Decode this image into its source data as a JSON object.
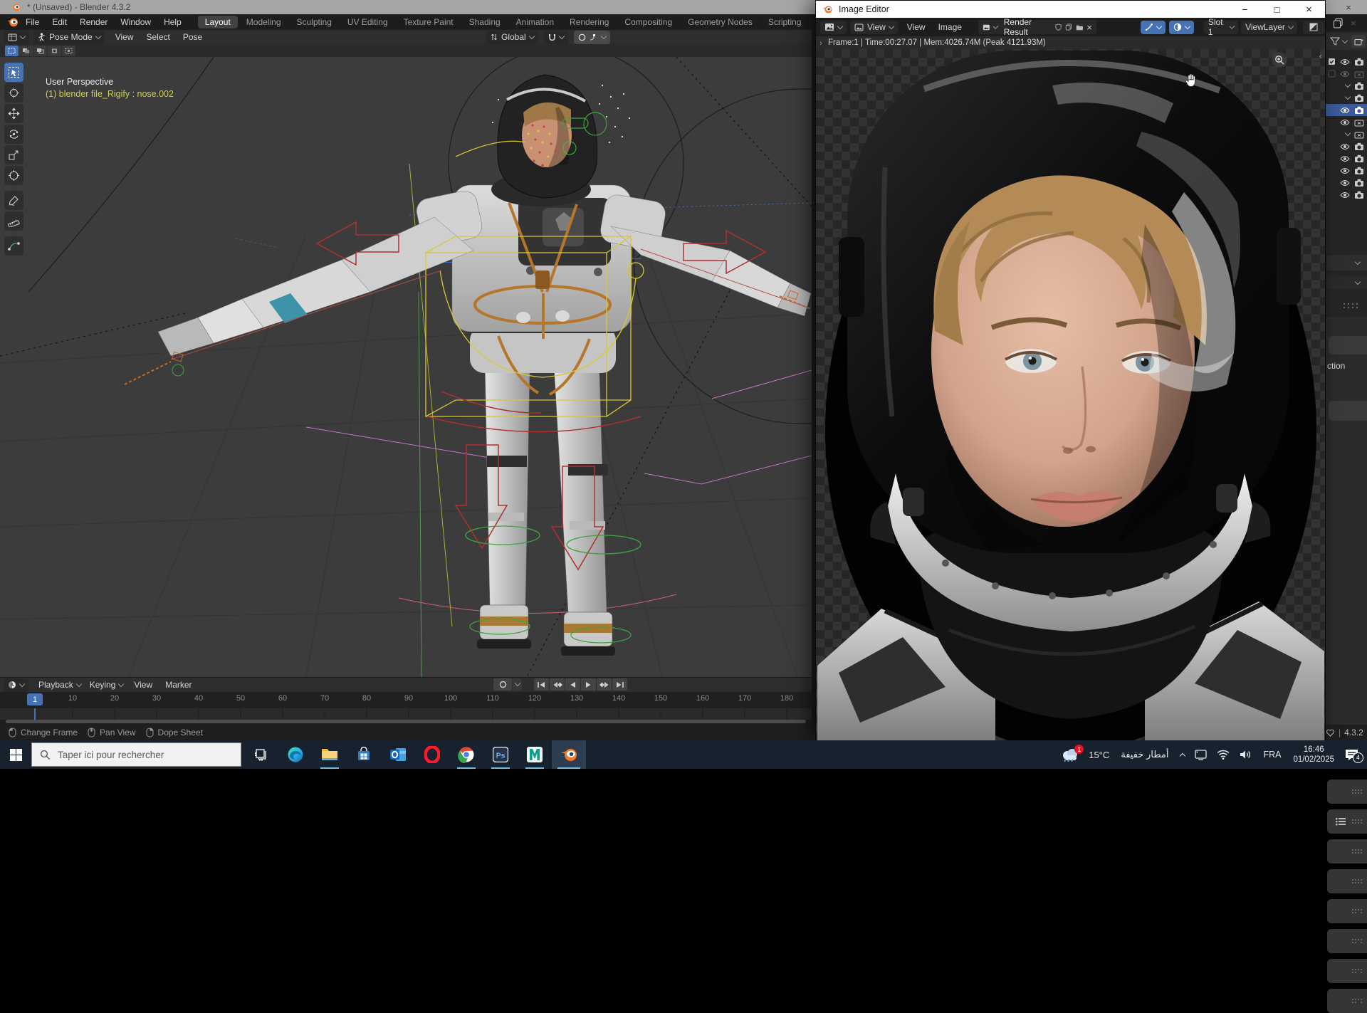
{
  "colors": {
    "accent": "#4772b3",
    "selection_row": "#3b5b98",
    "object_info_yellow": "#cfcf4a",
    "taskbar": "#18222e"
  },
  "icons": {
    "tray_expand": "∧",
    "collapse_left": "‹",
    "collapse_right": "›"
  },
  "main_window": {
    "title": "* (Unsaved) - Blender 4.3.2",
    "close_glyph": "×",
    "menus": [
      "File",
      "Edit",
      "Render",
      "Window",
      "Help"
    ],
    "workspaces": [
      "Layout",
      "Modeling",
      "Sculpting",
      "UV Editing",
      "Texture Paint",
      "Shading",
      "Animation",
      "Rendering",
      "Compositing",
      "Geometry Nodes",
      "Scripting"
    ],
    "add_workspace": "+"
  },
  "tool_header": {
    "mode": "Pose Mode",
    "menus": [
      "View",
      "Select",
      "Pose"
    ],
    "orientation": "Global"
  },
  "viewport": {
    "overlay_title": "User Perspective",
    "overlay_info": "(1) blender file_Rigify : nose.002"
  },
  "timeline": {
    "menus": [
      "Playback",
      "Keying",
      "View",
      "Marker"
    ],
    "current_frame": "1",
    "ticks": [
      "10",
      "20",
      "30",
      "40",
      "50",
      "60",
      "70",
      "80",
      "90",
      "100",
      "110",
      "120",
      "130",
      "140",
      "150",
      "160",
      "170",
      "180"
    ]
  },
  "status_bar": {
    "hints": [
      "Change Frame",
      "Pan View",
      "Dope Sheet"
    ],
    "version": "4.3.2"
  },
  "image_editor": {
    "window_title": "Image Editor",
    "controls": {
      "minimize": "−",
      "maximize": "□",
      "close": "×"
    },
    "mode": "View",
    "menus": [
      "View",
      "Image"
    ],
    "image_name": "Render Result",
    "slot": "Slot 1",
    "view_layer": "ViewLayer",
    "stats": "Frame:1 | Time:00:27.07 | Mem:4026.74M (Peak 4121.93M)"
  },
  "right_strip": {
    "properties_fragment": "ction"
  },
  "taskbar": {
    "search_placeholder": "Taper ici pour rechercher",
    "apps": [
      "task-view",
      "edge",
      "file-explorer",
      "store",
      "outlook",
      "opera",
      "chrome",
      "photoshop",
      "maya",
      "blender"
    ],
    "tray": {
      "weather_badge": "1",
      "temperature": "15°C",
      "weather_text": "أمطار خفيفة",
      "language": "FRA",
      "time": "16:46",
      "date": "01/02/2025",
      "notification_count": "4"
    }
  }
}
